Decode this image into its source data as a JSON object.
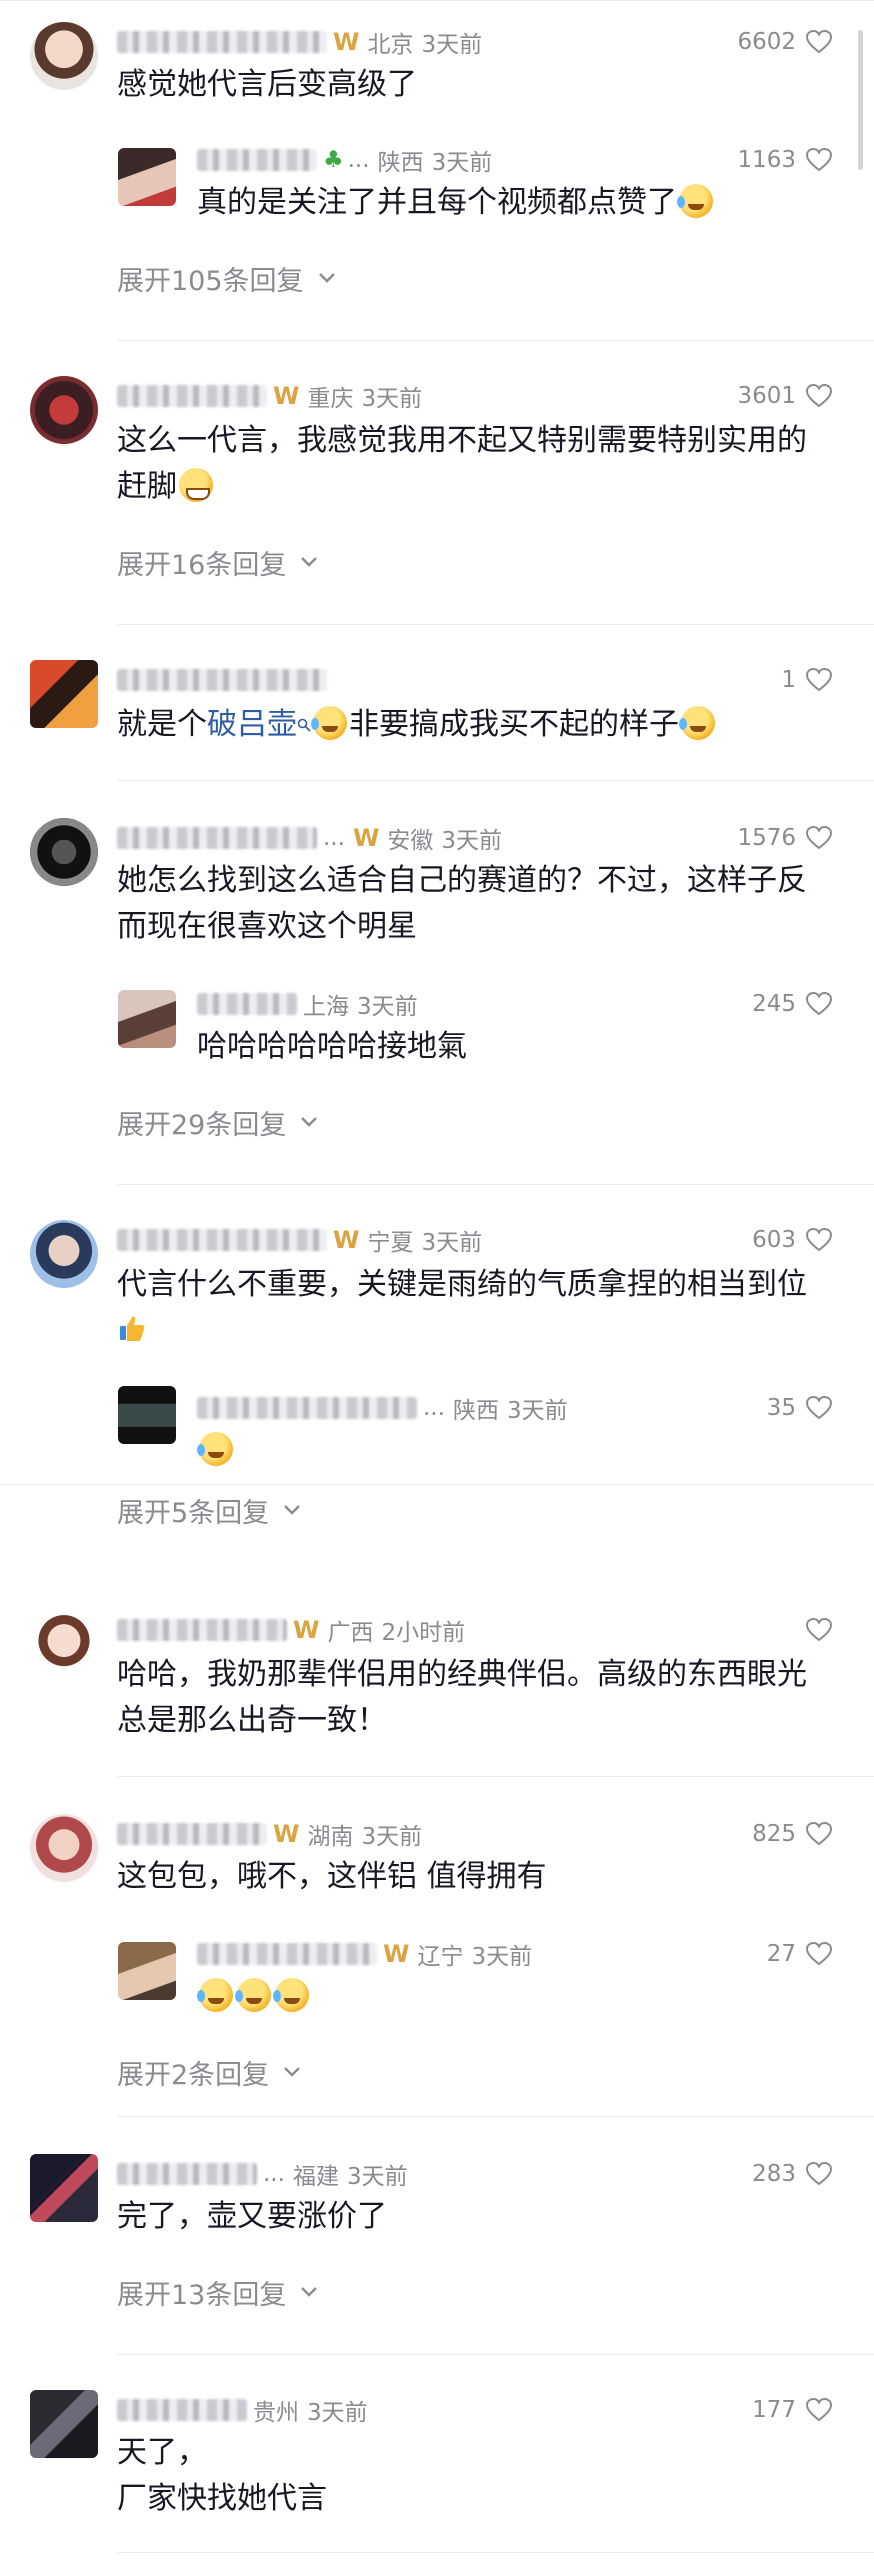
{
  "comments": [
    {
      "location": "北京",
      "time": "3天前",
      "likes": "6602",
      "text": "感觉她代言后变高级了",
      "replies": [
        {
          "location": "陕西",
          "time": "3天前",
          "likes": "1163",
          "text": "真的是关注了并且每个视频都点赞了"
        }
      ],
      "expand": "展开105条回复"
    },
    {
      "location": "重庆",
      "time": "3天前",
      "likes": "3601",
      "text": "这么一代言，我感觉我用不起又特别需要特别实用的赶脚",
      "expand": "展开16条回复"
    },
    {
      "likes": "1",
      "text_prefix": "就是个",
      "text_link": "破吕壶",
      "text_suffix": "非要搞成我买不起的样子"
    },
    {
      "location": "安徽",
      "time": "3天前",
      "likes": "1576",
      "text": "她怎么找到这么适合自己的赛道的？不过，这样子反而现在很喜欢这个明星",
      "replies": [
        {
          "location": "上海",
          "time": "3天前",
          "likes": "245",
          "text": "哈哈哈哈哈哈接地氣"
        }
      ],
      "expand": "展开29条回复"
    },
    {
      "location": "宁夏",
      "time": "3天前",
      "likes": "603",
      "text": "代言什么不重要，关键是雨绮的气质拿捏的相当到位",
      "replies": [
        {
          "location": "陕西",
          "time": "3天前",
          "likes": "35",
          "text": ""
        }
      ],
      "expand": "展开5条回复"
    },
    {
      "location": "广西",
      "time": "2小时前",
      "likes": "",
      "text": "哈哈，我奶那辈伴侣用的经典伴侣。高级的东西眼光总是那么出奇一致！"
    },
    {
      "location": "湖南",
      "time": "3天前",
      "likes": "825",
      "text": "这包包，哦不，这伴铝 值得拥有",
      "replies": [
        {
          "location": "辽宁",
          "time": "3天前",
          "likes": "27",
          "text": ""
        }
      ],
      "expand": "展开2条回复"
    },
    {
      "location": "福建",
      "time": "3天前",
      "likes": "283",
      "text": "完了，壶又要涨价了",
      "expand": "展开13条回复"
    },
    {
      "location": "贵州",
      "time": "3天前",
      "likes": "177",
      "text_line1": "天了，",
      "text_line2": "厂家快找她代言"
    }
  ],
  "ellipsis": "...",
  "colors": {
    "text": "#161823",
    "meta": "#8a8b91",
    "link": "#2e5da6",
    "badge": "#d9a441"
  }
}
